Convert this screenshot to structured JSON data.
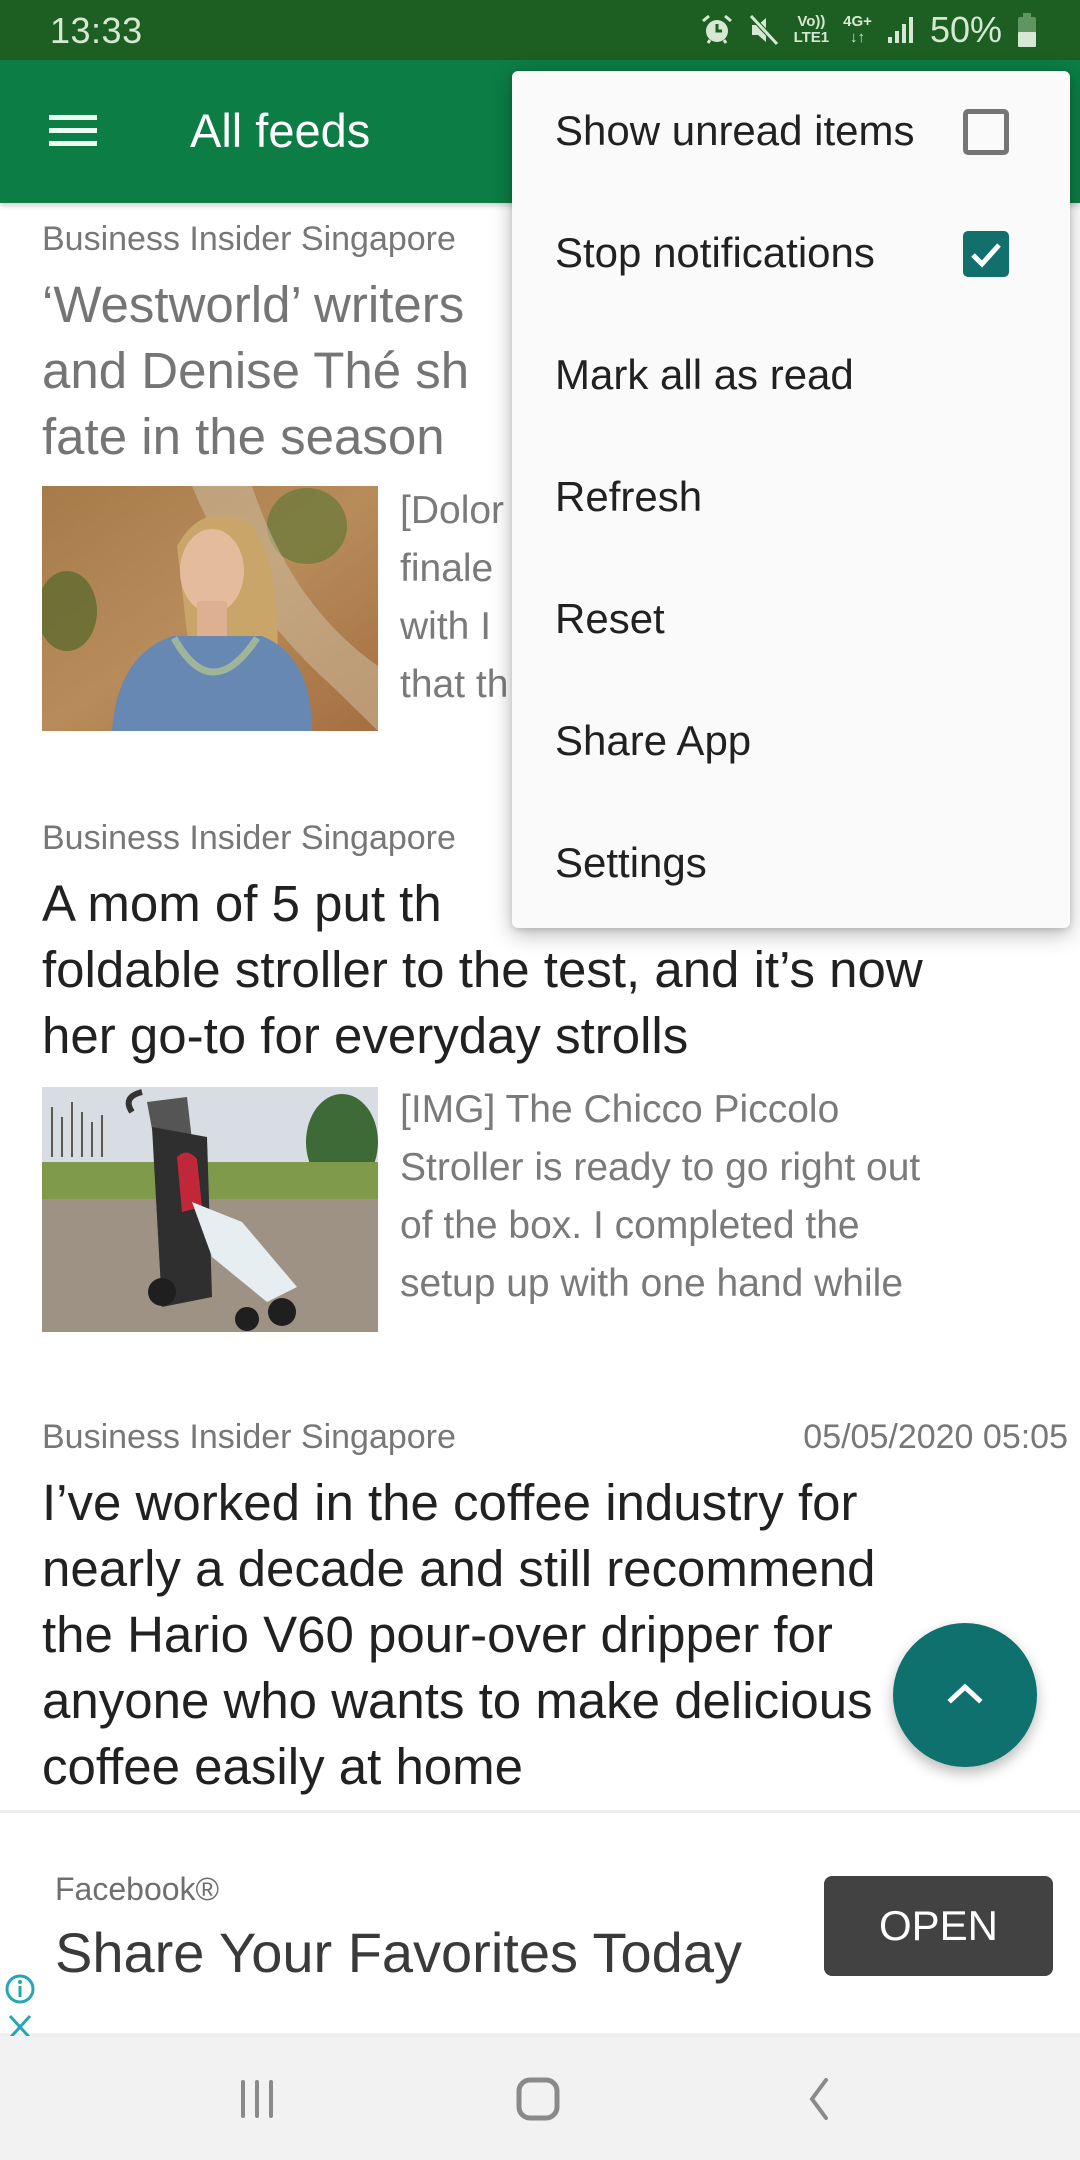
{
  "status_bar": {
    "time": "13:33",
    "icons": [
      "alarm-icon",
      "mute-icon",
      "volte-lte1-icon",
      "4g-plus-data-icon",
      "signal-icon",
      "battery-icon"
    ],
    "volte_label_top": "Vo))",
    "volte_label_bottom": "LTE1",
    "network_label_top": "4G+",
    "network_label_bottom": "↓↑",
    "battery_percent": "50%",
    "battery_level": 0.5
  },
  "app_bar": {
    "menu_icon": "hamburger-icon",
    "title": "All feeds",
    "color": "#0b7d45"
  },
  "articles": [
    {
      "source": "Business Insider Singapore",
      "date": "",
      "read": true,
      "title": "‘Westworld’ writers Lisa Joy and Denise Thé shed light on Dolores’ fate in the season",
      "title_visible": [
        "‘Westworld’ writers",
        "and Denise Thé sh",
        "fate in the season"
      ],
      "snippet_visible": [
        "[Dolor",
        "finale",
        "with I",
        "that th"
      ],
      "thumbnail": "woman-in-blue-dress-photo"
    },
    {
      "source": "Business Insider Singapore",
      "date": "",
      "read": false,
      "title_visible": [
        "A mom of 5 put th",
        "foldable stroller to the test, and it’s now",
        "her go-to for everyday strolls"
      ],
      "snippet": "[IMG] The Chicco Piccolo Stroller is ready to go right out of the box. I completed the setup up with one hand while",
      "snippet_lines": [
        "[IMG] The Chicco Piccolo",
        "Stroller is ready to go right out",
        "of the box. I completed the",
        "setup up with one hand while"
      ],
      "thumbnail": "stroller-photo"
    },
    {
      "source": "Business Insider Singapore",
      "date": "05/05/2020 05:05",
      "read": false,
      "title_lines": [
        "I’ve worked in the coffee industry for",
        "nearly a decade and still recommend",
        "the Hario V60 pour-over dripper for",
        "anyone who wants to make delicious",
        "coffee easily at home"
      ]
    }
  ],
  "overflow_menu": {
    "items": [
      {
        "label": "Show unread items",
        "checkbox": true,
        "checked": false
      },
      {
        "label": "Stop notifications",
        "checkbox": true,
        "checked": true
      },
      {
        "label": "Mark all as read"
      },
      {
        "label": "Refresh"
      },
      {
        "label": "Reset"
      },
      {
        "label": "Share App"
      },
      {
        "label": "Settings"
      }
    ]
  },
  "fab": {
    "icon": "chevron-up-icon",
    "color": "#0f716e"
  },
  "ad": {
    "advertiser": "Facebook®",
    "headline": "Share Your Favorites Today",
    "cta_label": "OPEN",
    "info_icon": "info-icon",
    "close_icon": "close-icon"
  },
  "nav_bar": {
    "buttons": [
      "recent-apps-icon",
      "home-icon",
      "back-icon"
    ]
  }
}
